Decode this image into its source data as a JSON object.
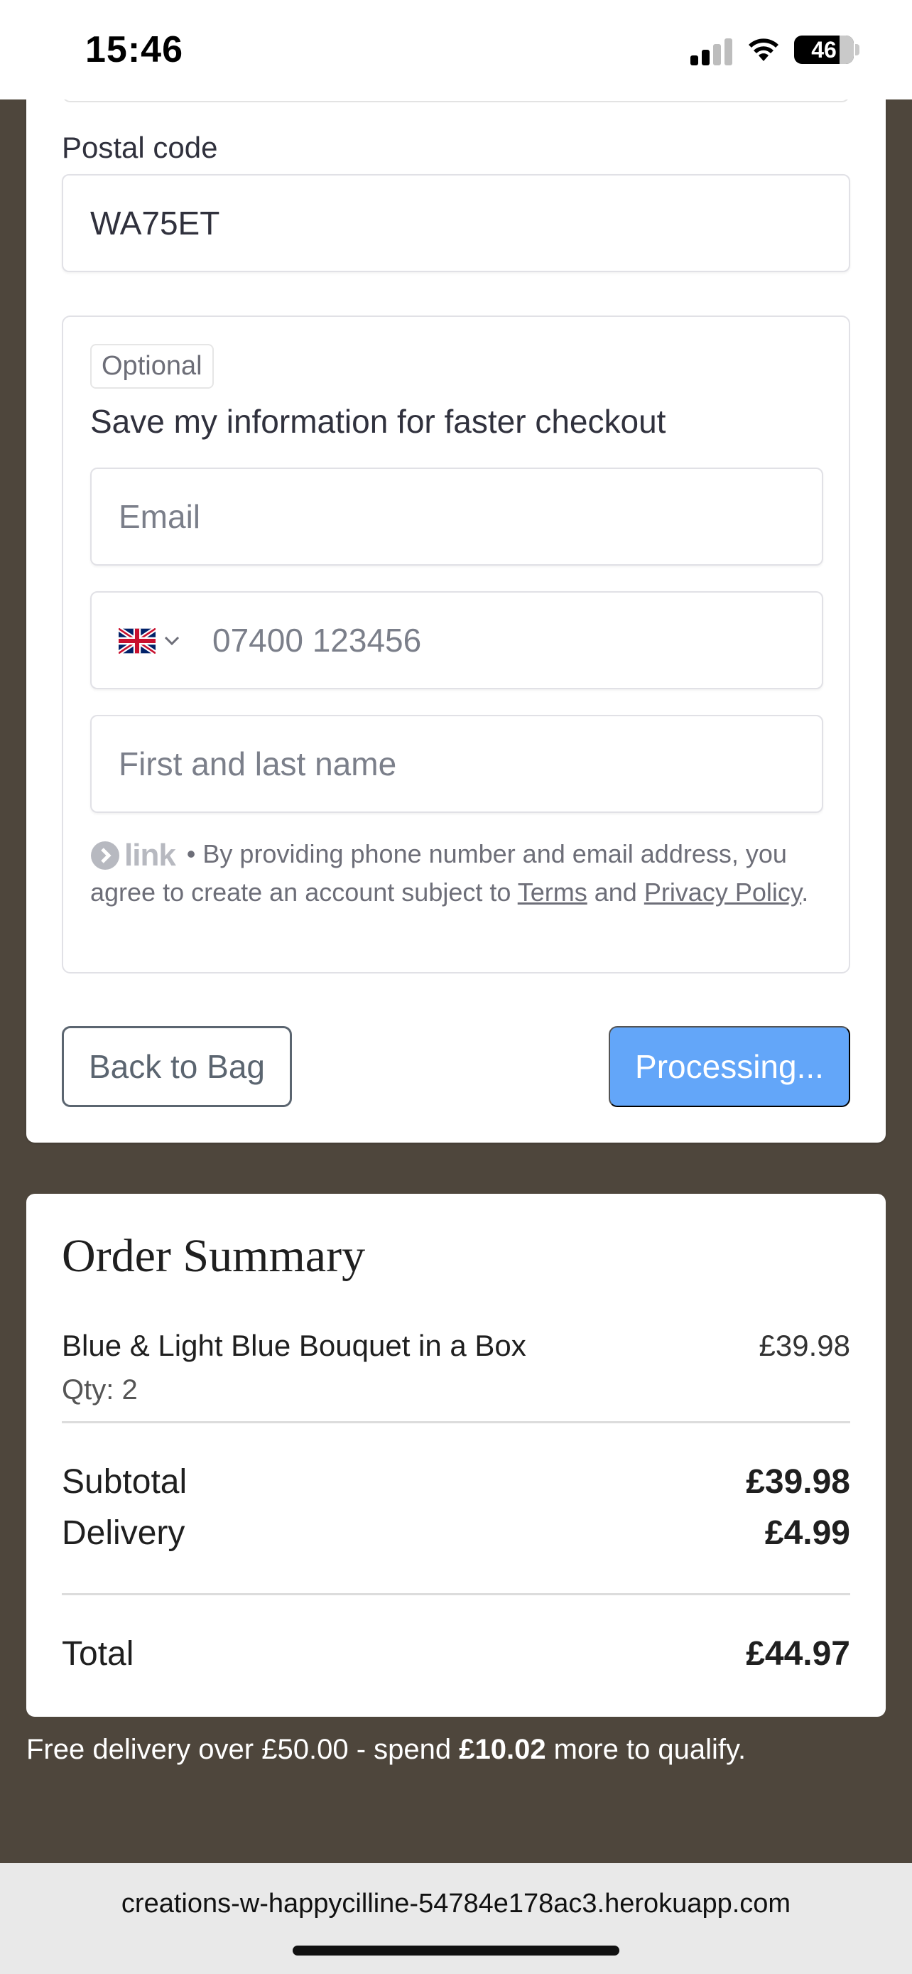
{
  "status_bar": {
    "time": "15:46",
    "battery": "46"
  },
  "form": {
    "postal_label": "Postal code",
    "postal_value": "WA75ET"
  },
  "link": {
    "optional_badge": "Optional",
    "heading": "Save my information for faster checkout",
    "email_placeholder": "Email",
    "phone_placeholder": "07400 123456",
    "country_flag": "uk-flag-icon",
    "name_placeholder": "First and last name",
    "logo_word": "link",
    "legal_prefix": " • By providing phone number and email address, you agree to create an account subject to ",
    "terms_link": "Terms",
    "legal_and": " and ",
    "privacy_link": "Privacy Policy",
    "legal_end": "."
  },
  "buttons": {
    "back": "Back to Bag",
    "submit": "Processing..."
  },
  "summary": {
    "title": "Order Summary",
    "item_name": "Blue & Light Blue Bouquet in a Box",
    "item_price": "£39.98",
    "item_qty": "Qty: 2",
    "subtotal_label": "Subtotal",
    "subtotal_value": "£39.98",
    "delivery_label": "Delivery",
    "delivery_value": "£4.99",
    "total_label": "Total",
    "total_value": "£44.97"
  },
  "delivery_note": {
    "prefix": "Free delivery over £50.00 - spend ",
    "amount": "£10.02",
    "suffix": " more to qualify."
  },
  "browser": {
    "url": "creations-w-happycilline-54784e178ac3.herokuapp.com"
  },
  "colors": {
    "accent": "#63a6f9",
    "page_bg": "#4e463c",
    "text": "#30313d"
  }
}
